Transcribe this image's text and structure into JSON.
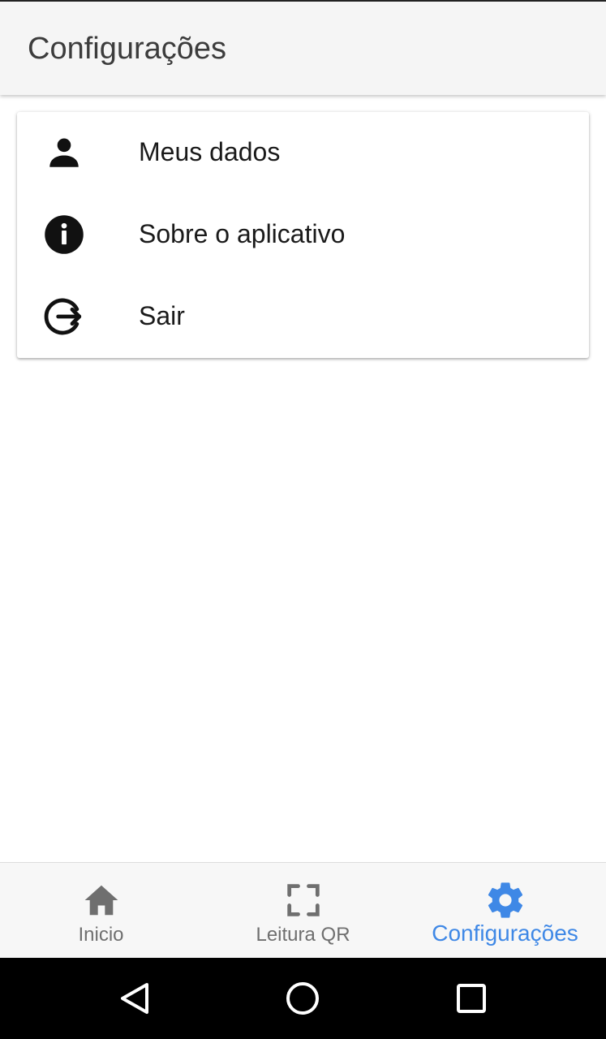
{
  "header": {
    "title": "Configurações"
  },
  "menu": {
    "items": [
      {
        "label": "Meus dados",
        "icon": "person-icon"
      },
      {
        "label": "Sobre o aplicativo",
        "icon": "info-icon"
      },
      {
        "label": "Sair",
        "icon": "logout-icon"
      }
    ]
  },
  "bottom_nav": {
    "tabs": [
      {
        "label": "Inicio",
        "icon": "home-icon",
        "active": false
      },
      {
        "label": "Leitura QR",
        "icon": "qr-scan-icon",
        "active": false
      },
      {
        "label": "Configurações",
        "icon": "gear-icon",
        "active": true
      }
    ]
  },
  "system_nav": {
    "buttons": [
      "back-icon",
      "home-circle-icon",
      "recents-icon"
    ]
  },
  "colors": {
    "accent": "#3f88e6",
    "inactive": "#6f6f6f",
    "icon_dark": "#111111"
  }
}
